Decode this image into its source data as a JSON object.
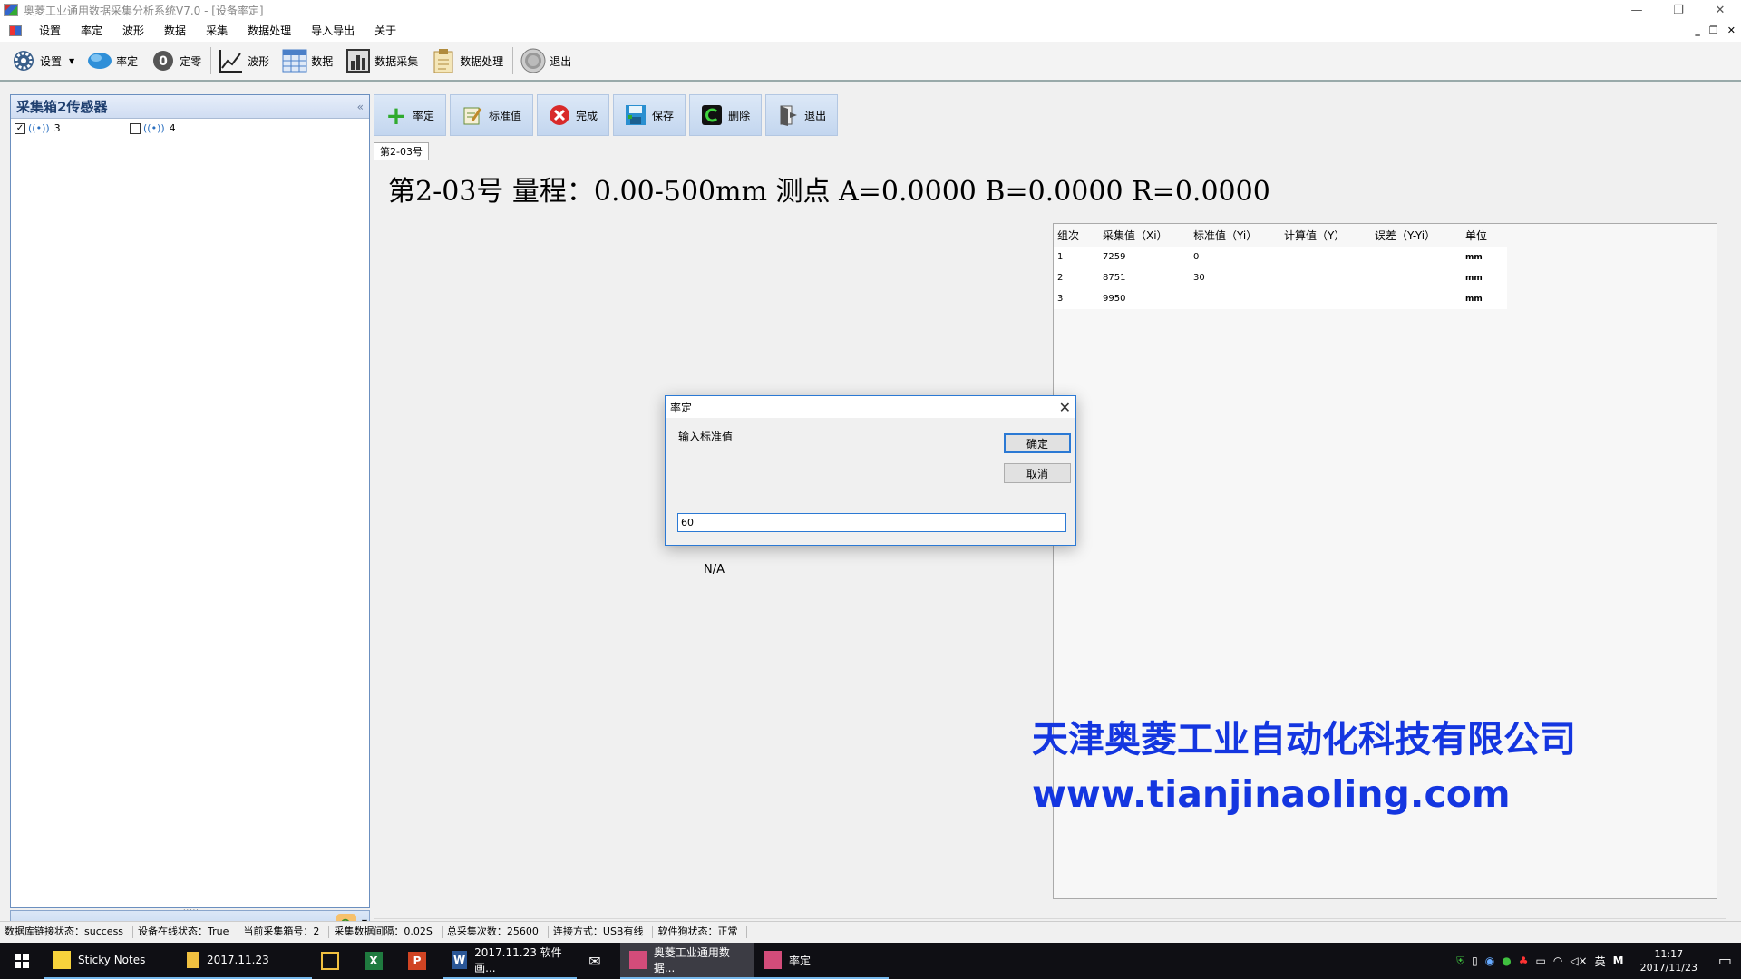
{
  "window": {
    "title": "奥菱工业通用数据采集分析系统V7.0 - [设备率定]",
    "controls": [
      "—",
      "❐",
      "✕"
    ],
    "mdi_controls": [
      "_",
      "❐",
      "✕"
    ]
  },
  "menu": [
    "设置",
    "率定",
    "波形",
    "数据",
    "采集",
    "数据处理",
    "导入导出",
    "关于"
  ],
  "toolbar": [
    {
      "label": "设置",
      "icon": "gear-icon",
      "color": "#3a5f8a"
    },
    {
      "label": "率定",
      "icon": "calibrate-icon",
      "color": "#2f8fd8"
    },
    {
      "label": "定零",
      "icon": "zero-icon",
      "color": "#555555"
    },
    {
      "label": "波形",
      "icon": "waveform-icon",
      "color": "#222222"
    },
    {
      "label": "数据",
      "icon": "table-icon",
      "color": "#4a7fc8"
    },
    {
      "label": "数据采集",
      "icon": "data-collect-icon",
      "color": "#333333"
    },
    {
      "label": "数据处理",
      "icon": "clipboard-icon",
      "color": "#b08b3c"
    },
    {
      "label": "退出",
      "icon": "power-icon",
      "color": "#777777"
    }
  ],
  "left_panel": {
    "title": "采集箱2传感器",
    "collapse": "«",
    "sensors": [
      {
        "label": "3",
        "checked": true
      },
      {
        "label": "4",
        "checked": false
      }
    ]
  },
  "action_bar": [
    {
      "label": "率定",
      "icon": "plus-icon",
      "color": "#2faa2f"
    },
    {
      "label": "标准值",
      "icon": "edit-icon",
      "color": "#6a8f3a"
    },
    {
      "label": "完成",
      "icon": "close-circle-icon",
      "color": "#d82a2a"
    },
    {
      "label": "保存",
      "icon": "save-icon",
      "color": "#2a8fd0"
    },
    {
      "label": "删除",
      "icon": "delete-icon",
      "color": "#2a9a2a"
    },
    {
      "label": "退出",
      "icon": "exit-icon",
      "color": "#555555"
    }
  ],
  "tab": {
    "label": "第2-03号"
  },
  "info": {
    "text": "第2-03号 量程：0.00-500mm 测点 A=0.0000 B=0.0000 R=0.0000"
  },
  "table": {
    "columns": [
      "组次",
      "采集值（Xi）",
      "标准值（Yi）",
      "计算值（Y）",
      "误差（Y-Yi）",
      "单位"
    ],
    "rows": [
      [
        "1",
        "7259",
        "0",
        "",
        "",
        "mm"
      ],
      [
        "2",
        "8751",
        "30",
        "",
        "",
        "mm"
      ],
      [
        "3",
        "9950",
        "",
        "",
        "",
        "mm"
      ]
    ]
  },
  "na_label": "N/A",
  "watermark": {
    "company": "天津奥菱工业自动化科技有限公司",
    "url": "www.tianjinaoling.com",
    "color": "#1436e0"
  },
  "dialog": {
    "title": "率定",
    "close": "✕",
    "prompt": "输入标准值",
    "ok": "确定",
    "cancel": "取消",
    "value": "60"
  },
  "status": [
    "数据库链接状态：success",
    "设备在线状态：True",
    "当前采集箱号：2",
    "采集数据间隔：0.02S",
    "总采集次数：25600",
    "连接方式：USB有线",
    "软件狗状态：正常"
  ],
  "taskbar": {
    "items": [
      {
        "label": "Sticky Notes",
        "icon": "sticky-notes-icon",
        "color": "#f7d33c",
        "wide": true,
        "active": false
      },
      {
        "label": "2017.11.23",
        "icon": "folder-icon",
        "color": "#f0c040",
        "wide": true,
        "active": false
      },
      {
        "label": "",
        "icon": "store-icon",
        "color": "#f0c040",
        "wide": false,
        "active": false
      },
      {
        "label": "",
        "icon": "excel-icon",
        "color": "#1f7a3f",
        "wide": false,
        "active": false
      },
      {
        "label": "",
        "icon": "powerpoint-icon",
        "color": "#d04423",
        "wide": false,
        "active": false
      },
      {
        "label": "2017.11.23 软件画...",
        "icon": "word-icon",
        "color": "#2b5797",
        "wide": true,
        "active": false
      },
      {
        "label": "",
        "icon": "mail-icon",
        "color": "#ffffff",
        "wide": false,
        "active": false
      },
      {
        "label": "奥菱工业通用数据...",
        "icon": "app-icon",
        "color": "#d34c7a",
        "wide": true,
        "active": true
      },
      {
        "label": "率定",
        "icon": "app-icon",
        "color": "#d34c7a",
        "wide": true,
        "active": false
      }
    ],
    "tray_lang": "英",
    "time": "11:17",
    "date": "2017/11/23"
  }
}
